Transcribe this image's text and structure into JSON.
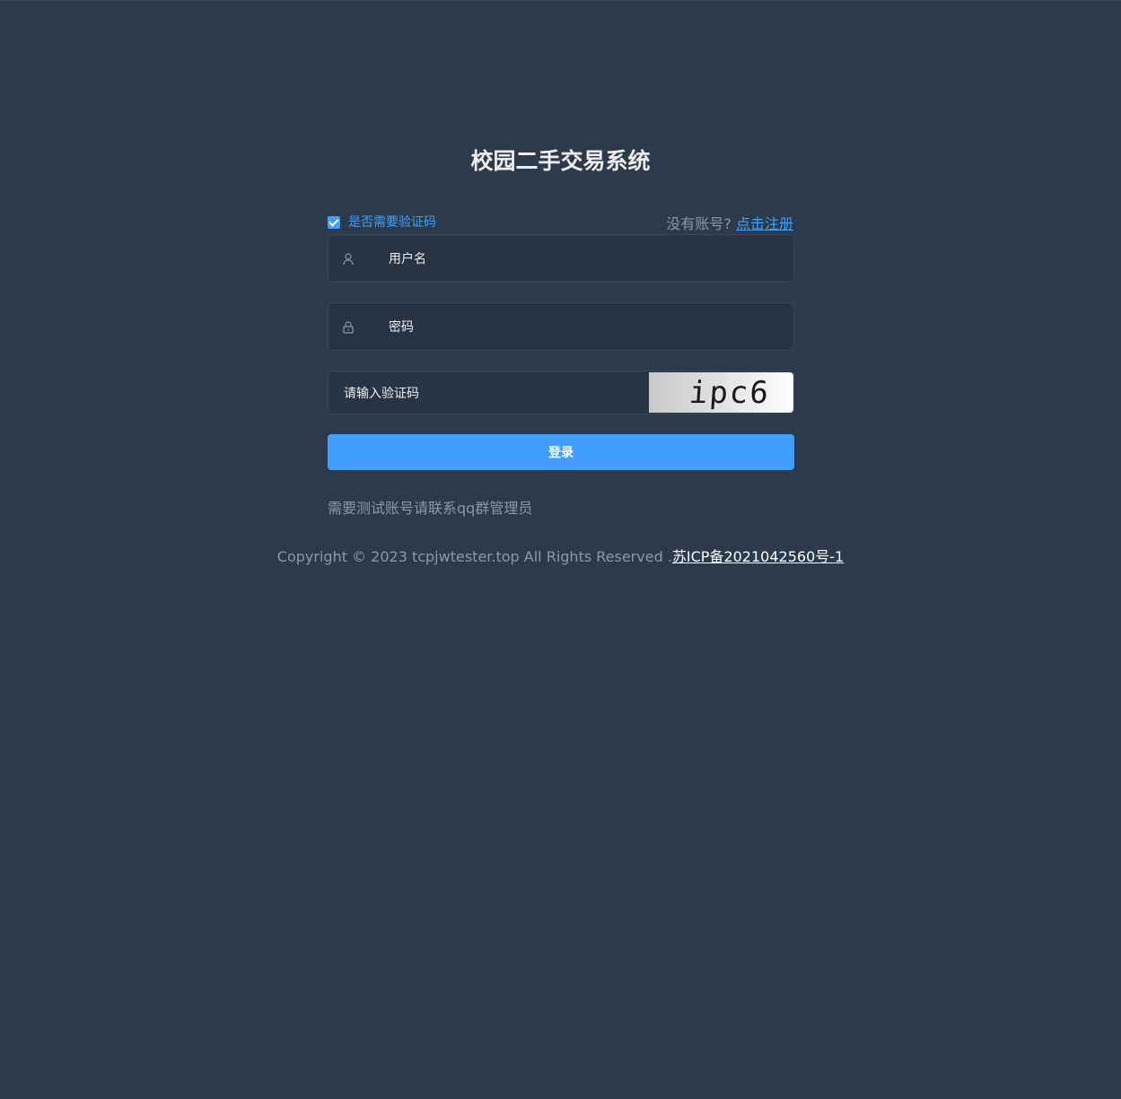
{
  "login": {
    "title": "校园二手交易系统",
    "captcha_toggle_label": "是否需要验证码",
    "captcha_toggle_checked": true,
    "register_prompt": "没有账号?",
    "register_link": "点击注册",
    "username_placeholder": "用户名",
    "password_placeholder": "密码",
    "captcha_placeholder": "请输入验证码",
    "captcha_code": "ipc6",
    "login_button": "登录",
    "tip": "需要测试账号请联系qq群管理员"
  },
  "footer": {
    "copyright": "Copyright © 2023 tcpjwtester.top All Rights Reserved .",
    "icp": "苏ICP备2021042560号-1"
  },
  "colors": {
    "background": "#2d3a4b",
    "accent": "#409eff",
    "input_bg": "#283443",
    "muted_text": "#889aa4"
  },
  "icons": {
    "username": "user-icon",
    "password": "lock-icon"
  }
}
